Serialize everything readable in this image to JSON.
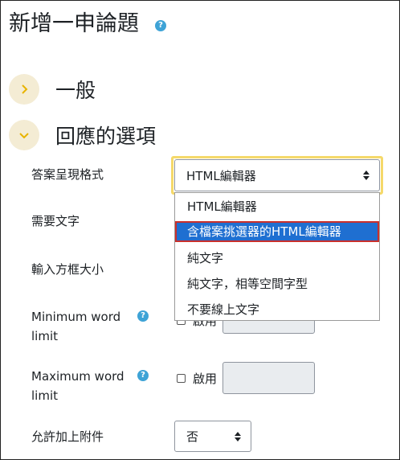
{
  "page": {
    "title": "新增一申論題",
    "help_icon": "?"
  },
  "sections": {
    "general": {
      "label": "一般",
      "icon": "chevron-right-icon"
    },
    "response": {
      "label": "回應的選項",
      "icon": "chevron-down-icon"
    }
  },
  "fields": {
    "format": {
      "label": "答案呈現格式",
      "value": "HTML編輯器",
      "options": [
        "HTML編輯器",
        "含檔案挑選器的HTML編輯器",
        "純文字",
        "純文字，相等空間字型",
        "不要線上文字"
      ],
      "highlighted": "含檔案挑選器的HTML編輯器"
    },
    "required": {
      "label": "需要文字"
    },
    "input_size": {
      "label": "輸入方框大小"
    },
    "min_word": {
      "label_line1": "Minimum word",
      "label_line2": "limit",
      "enable_label": "啟用"
    },
    "max_word": {
      "label_line1": "Maximum word",
      "label_line2": "limit",
      "enable_label": "啟用"
    },
    "attachments": {
      "label": "允許加上附件",
      "value": "否"
    }
  },
  "colors": {
    "accent": "#f5d96a",
    "chevron": "#e8b300",
    "help": "#3ea3d6",
    "selected": "#1f6fd1",
    "selected_outline": "#c9302c"
  }
}
